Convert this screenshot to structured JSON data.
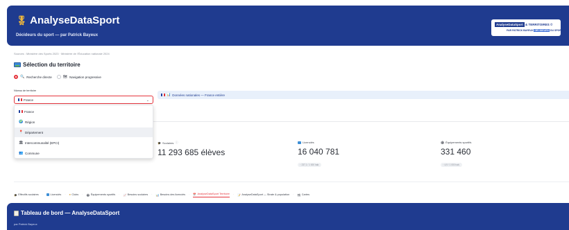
{
  "header": {
    "title": "AnalyseDataSport",
    "medal_icon": "medal-icon",
    "subtitle": "Décideurs du sport — par Patrick Bayeux",
    "logo": {
      "line1_chip": "AnalyseDataSport",
      "line1_rest": "& TERRITOIRES ©",
      "line2_pre": "PAR PATRICK BAYEUX",
      "line2_chip": "DÉCIDEURS",
      "line2_post": "DU SPORT"
    }
  },
  "sources": "Sources : Ministère des Sports 2023 · Ministère de l'Éducation nationale 2024",
  "territory": {
    "title": "Sélection du territoire",
    "mode_direct": "Recherche directe",
    "mode_progressive": "Navigation progressive",
    "level_label": "Niveau de territoire",
    "selected": "France",
    "options": [
      {
        "label": "France",
        "icon": "france-flag-icon"
      },
      {
        "label": "Région",
        "icon": "globe-icon"
      },
      {
        "label": "Département",
        "icon": "pin-icon"
      },
      {
        "label": "Intercommunalité (EPCI)",
        "icon": "building-icon"
      },
      {
        "label": "Commune",
        "icon": "people-icon"
      }
    ],
    "national_banner": "Données nationales — France entière"
  },
  "metrics": [
    {
      "label": "Scolaires",
      "value": "11 293 685 élèves",
      "delta": "",
      "icon": "graduation-cap-icon"
    },
    {
      "label": "Licenciés",
      "value": "16 040 781",
      "delta": "↑ 237,1 / 1 000 hab.",
      "icon": "id-card-icon"
    },
    {
      "label": "Équipements sportifs",
      "value": "331 460",
      "delta": "↑ 4,9 / 1 000 hab.",
      "icon": "stadium-icon"
    }
  ],
  "tabs": [
    {
      "label": "Effectifs scolaires",
      "icon": "graduation-cap-icon",
      "active": false
    },
    {
      "label": "Licenciés",
      "icon": "id-card-icon",
      "active": false
    },
    {
      "label": "Clubs",
      "icon": "trophy-icon",
      "active": false
    },
    {
      "label": "Équipements sportifs",
      "icon": "stadium-icon",
      "active": false
    },
    {
      "label": "Besoins scolaires",
      "icon": "chart-icon",
      "active": false
    },
    {
      "label": "Besoins des licenciés",
      "icon": "bar-chart-icon",
      "active": false
    },
    {
      "label": "AnalyseDataSport Territoire",
      "icon": "calendar-icon",
      "active": true
    },
    {
      "label": "AnalyseDataSport — Strate & population",
      "icon": "pencil-chart-icon",
      "active": false
    },
    {
      "label": "Cartes",
      "icon": "map-icon",
      "active": false
    }
  ],
  "dashboard": {
    "title": "Tableau de bord — AnalyseDataSport",
    "subtitle": "par Patrick Bayeux"
  },
  "colors": {
    "brand_blue": "#1f3b8f",
    "accent_red": "#e5343c",
    "banner_bg": "#e8f0fb"
  }
}
